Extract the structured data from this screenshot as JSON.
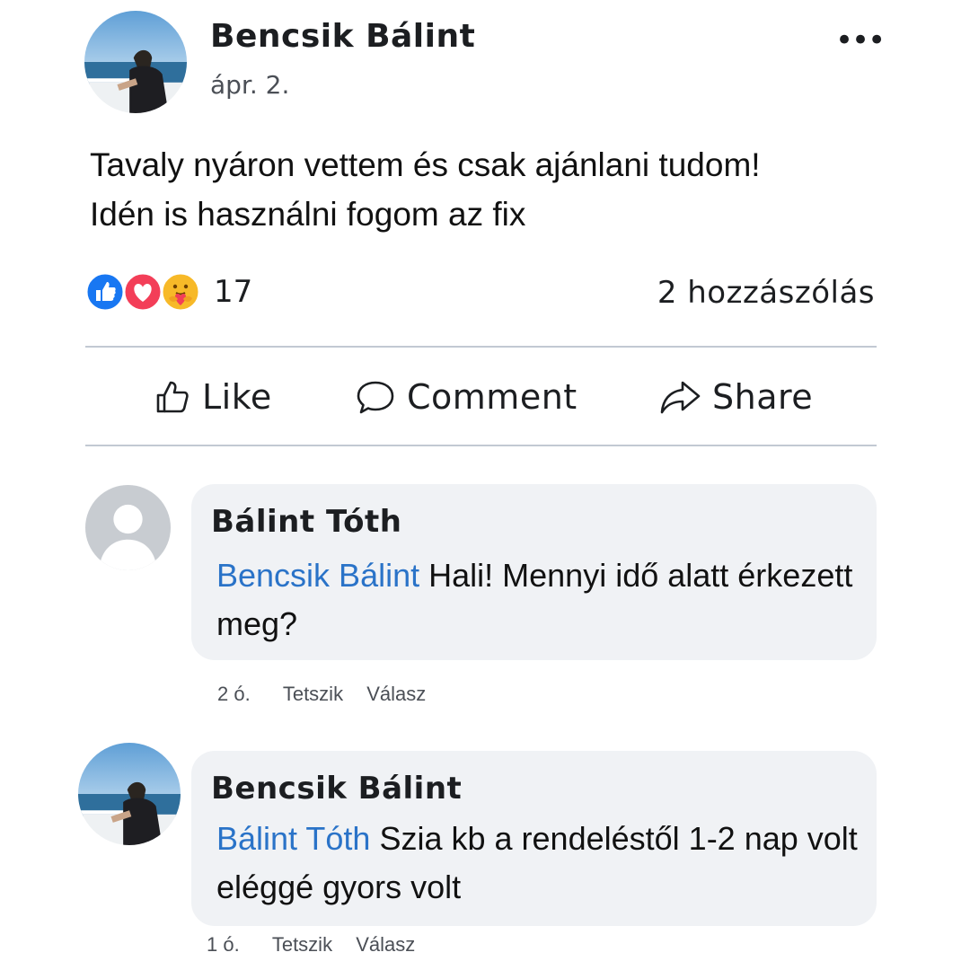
{
  "post": {
    "author": "Bencsik Bálint",
    "date": "ápr. 2.",
    "more_label": "•••",
    "text": "Tavaly nyáron vettem és csak ajánlani tudom! Idén is használni fogom az fix",
    "reaction_icons": [
      "like-icon",
      "love-icon",
      "care-icon"
    ],
    "reaction_count": "17",
    "comment_count": "2 hozzászólás"
  },
  "actions": {
    "like": "Like",
    "comment": "Comment",
    "share": "Share"
  },
  "comments": [
    {
      "author": "Bálint Tóth",
      "mention": "Bencsik Bálint",
      "text": "Hali! Mennyi idő alatt érkezett meg?",
      "time": "2 ó.",
      "like": "Tetszik",
      "reply": "Válasz"
    },
    {
      "author": "Bencsik Bálint",
      "mention": "Bálint Tóth",
      "text": "Szia kb a rendeléstől 1-2 nap volt eléggé gyors volt",
      "time": "1 ó.",
      "like": "Tetszik",
      "reply": "Válasz"
    }
  ],
  "colors": {
    "mention": "#2a73c8",
    "bubble": "#f0f2f5",
    "divider": "#c2c9d3",
    "like_blue": "#1877f2",
    "love_red": "#f33e58",
    "care_yellow": "#f7b928"
  }
}
